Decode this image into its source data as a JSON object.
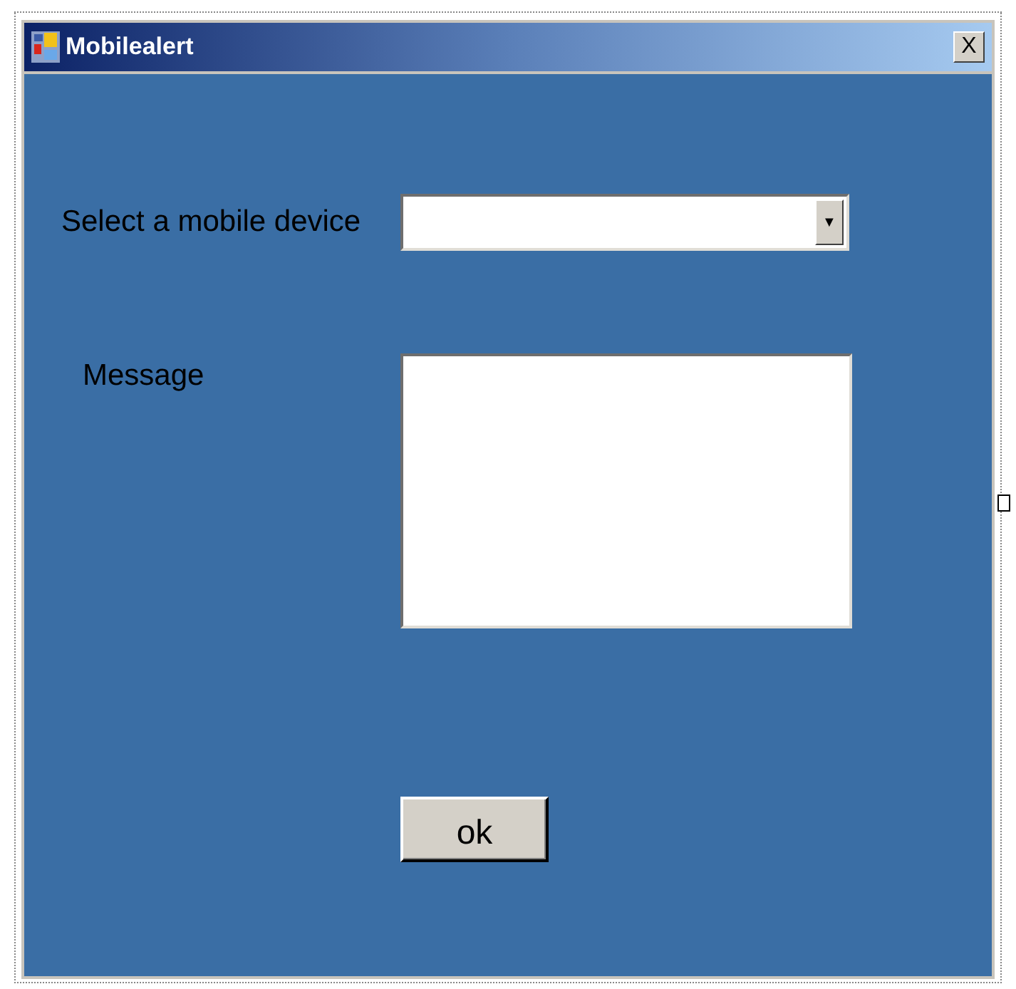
{
  "window": {
    "title": "Mobilealert",
    "close_button": "X"
  },
  "form": {
    "device_label": "Select a mobile device",
    "device_dropdown_arrow": "▼",
    "message_label": "Message",
    "ok_button": "ok"
  }
}
